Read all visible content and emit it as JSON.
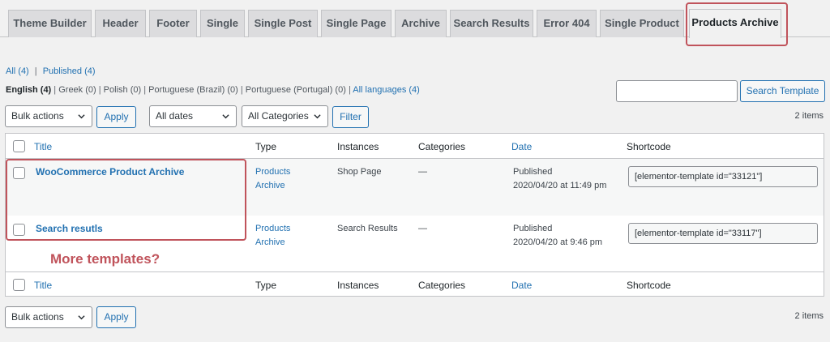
{
  "tabs": [
    {
      "label": "Theme Builder"
    },
    {
      "label": "Header"
    },
    {
      "label": "Footer"
    },
    {
      "label": "Single"
    },
    {
      "label": "Single Post"
    },
    {
      "label": "Single Page"
    },
    {
      "label": "Archive"
    },
    {
      "label": "Search Results"
    },
    {
      "label": "Error 404"
    },
    {
      "label": "Single Product"
    },
    {
      "label": "Products Archive",
      "active": true
    }
  ],
  "status_links": {
    "all": "All (4)",
    "separator": "|",
    "published": "Published (4)"
  },
  "languages": {
    "english": "English (4)",
    "greek": "Greek (0)",
    "polish": "Polish (0)",
    "portuguese_brazil": "Portuguese (Brazil) (0)",
    "portuguese_portugal": "Portuguese (Portugal) (0)",
    "all_languages": "All languages (4)",
    "separator": "|"
  },
  "search": {
    "value": "",
    "button_label": "Search Template"
  },
  "top_filters": {
    "bulk_actions": "Bulk actions",
    "apply_label": "Apply",
    "dates": "All dates",
    "categories": "All Categories",
    "filter_label": "Filter",
    "items_count": "2 items"
  },
  "table": {
    "columns": {
      "title": "Title",
      "type": "Type",
      "instances": "Instances",
      "categories": "Categories",
      "date": "Date",
      "shortcode": "Shortcode"
    },
    "rows": [
      {
        "title": "WooCommerce Product Archive",
        "type_line1": "Products",
        "type_line2": "Archive",
        "instances": "Shop Page",
        "categories": "—",
        "date_status": "Published",
        "date_value": "2020/04/20 at 11:49 pm",
        "shortcode": "[elementor-template id=\"33121\"]"
      },
      {
        "title": "Search resutls",
        "type_line1": "Products",
        "type_line2": "Archive",
        "instances": "Search Results",
        "categories": "—",
        "date_status": "Published",
        "date_value": "2020/04/20 at 9:46 pm",
        "shortcode": "[elementor-template id=\"33117\"]"
      }
    ]
  },
  "bottom_filters": {
    "bulk_actions": "Bulk actions",
    "apply_label": "Apply",
    "items_count": "2 items"
  },
  "annotation": {
    "text": "More templates?",
    "color": "#c0535b"
  },
  "colors": {
    "link": "#2271b1",
    "highlight": "#c0535b",
    "background": "#f1f1f1"
  }
}
